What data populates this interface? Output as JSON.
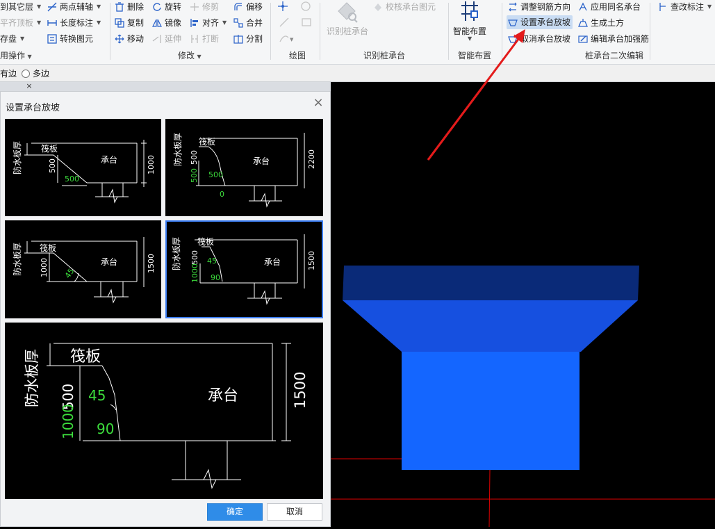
{
  "ribbon": {
    "col1": {
      "item1": "到其它层",
      "item2": "平齐顶板",
      "item3": "存盘",
      "group": "用操作"
    },
    "col2": {
      "item1": "两点辅轴",
      "item2": "长度标注",
      "item3": "转换图元"
    },
    "modify": {
      "delete": "删除",
      "rotate": "旋转",
      "trim": "修剪",
      "offset": "偏移",
      "copy": "复制",
      "mirror": "镜像",
      "align": "对齐",
      "merge": "合并",
      "move": "移动",
      "extend": "延伸",
      "break": "打断",
      "split": "分割",
      "group": "修改"
    },
    "draw": {
      "group": "绘图"
    },
    "identify": {
      "identify_label": "识别桩承台",
      "check_label": "校核承台图元",
      "group": "识别桩承台"
    },
    "smart": {
      "label": "智能布置",
      "group": "智能布置"
    },
    "pile_edit": {
      "adjust_rebar": "调整钢筋方向",
      "set_slope": "设置承台放坡",
      "cancel_slope": "取消承台放坡",
      "apply_same": "应用同名承台",
      "gen_earth": "生成土方",
      "edit_reinf": "编辑承台加强筋",
      "group": "桩承台二次编辑"
    },
    "check_mark": "查改标注"
  },
  "optbar": {
    "opt1": "有边",
    "opt2": "多边"
  },
  "dialog": {
    "title": "设置承台放坡",
    "ok": "确定",
    "cancel": "取消",
    "options": [
      {
        "waterproof": "防水板厚",
        "raft": "筏板",
        "cap": "承台",
        "dim_vertical": "500",
        "dim_horizontal": "500",
        "dim_total": "1000"
      },
      {
        "waterproof": "防水板厚",
        "raft": "筏板",
        "cap": "承台",
        "dim_upper": "500",
        "dim_green_v": "500",
        "dim_green_h": "500",
        "dim_zero": "0",
        "dim_total": "2200"
      },
      {
        "waterproof": "防水板厚",
        "raft": "筏板",
        "cap": "承台",
        "dim_vertical": "1000",
        "angle": "45",
        "dim_total": "1500"
      },
      {
        "waterproof": "防水板厚",
        "raft": "筏板",
        "cap": "承台",
        "dim_upper": "500",
        "dim_green": "1000",
        "angle1": "45",
        "angle2": "90",
        "dim_total": "1500"
      }
    ],
    "preview": {
      "waterproof": "防水板厚",
      "raft": "筏板",
      "cap": "承台",
      "dim_upper": "500",
      "dim_green": "1000",
      "angle1": "45",
      "angle2": "90",
      "dim_total": "1500"
    }
  },
  "colors": {
    "accent": "#2f8ce8",
    "cap_top": "#0a2a78",
    "cap_front": "#1650e0",
    "cap_body": "#1466ff",
    "annotation_arrow": "#e31b1b"
  }
}
